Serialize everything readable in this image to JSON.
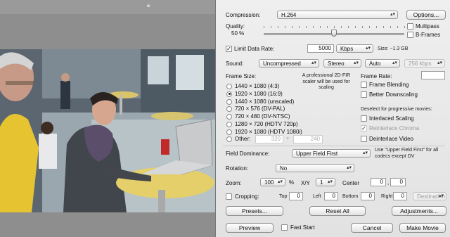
{
  "preview": {
    "glyph": "⚭"
  },
  "compression": {
    "label": "Compression:",
    "value": "H.264",
    "options_button": "Options..."
  },
  "quality": {
    "label": "Quality:",
    "value": "50 %",
    "level": 0.5
  },
  "multipass": {
    "label": "Multipass",
    "checked": false
  },
  "bframes": {
    "label": "B-Frames",
    "checked": false
  },
  "data_rate": {
    "label": "Limit Data Rate:",
    "checked": true,
    "value": "5000",
    "unit": "Kbps",
    "size": "Size: ~1.3 GB"
  },
  "sound": {
    "label": "Sound:",
    "codec": "Uncompressed",
    "channels": "Stereo",
    "rate": "Auto",
    "bitrate": "256 kbps"
  },
  "frame_size": {
    "label": "Frame Size:",
    "note": "A professional 2D-FIR scaler will be used for scaling",
    "options": [
      {
        "label": "1440 × 1080  (4:3)",
        "selected": false
      },
      {
        "label": "1920 × 1080  (16:9)",
        "selected": true
      },
      {
        "label": "1440 × 1080  (unscaled)",
        "selected": false
      },
      {
        "label": "720 × 576  (DV-PAL)",
        "selected": false
      },
      {
        "label": "720 × 480  (DV-NTSC)",
        "selected": false
      },
      {
        "label": "1280 × 720  (HDTV 720p)",
        "selected": false
      },
      {
        "label": "1920 × 1080  (HDTV 1080i)",
        "selected": false
      }
    ],
    "other_label": "Other:",
    "other_width": "320",
    "other_times": "×",
    "other_height": "240"
  },
  "frame_rate": {
    "label": "Frame Rate:",
    "value": "",
    "blending": {
      "label": "Frame Blending",
      "checked": false
    },
    "better": {
      "label": "Better Downscaling",
      "checked": false
    }
  },
  "deselect_note": "Deselect for progressive movies:",
  "interlaced": {
    "label": "Interlaced Scaling",
    "checked": false
  },
  "reinterlace": {
    "label": "Reinterlace Chroma",
    "checked": true,
    "disabled": true
  },
  "deinterlace": {
    "label": "Deinterlace Video",
    "checked": false
  },
  "field_dominance": {
    "label": "Field Dominance:",
    "value": "Upper Field First",
    "note": "Use \"Upper Field First\" for all codecs except DV"
  },
  "rotation": {
    "label": "Rotation:",
    "value": "No"
  },
  "zoom": {
    "label": "Zoom:",
    "value": "100",
    "percent": "%",
    "xy_label": "X/Y",
    "xy_value": "1",
    "center_label": "Center",
    "center_x": "0",
    "center_sep": ",",
    "center_y": "0"
  },
  "cropping": {
    "label": "Cropping:",
    "checked": false,
    "top_label": "Top",
    "top": "0",
    "left_label": "Left",
    "left": "0",
    "bottom_label": "Bottom",
    "bottom": "0",
    "right_label": "Right",
    "right": "0",
    "mode": "Destination"
  },
  "buttons": {
    "presets": "Presets...",
    "reset": "Reset All",
    "adjust": "Adjustments...",
    "preview": "Preview",
    "cancel": "Cancel",
    "make": "Make Movie"
  },
  "fast_start": {
    "label": "Fast Start",
    "checked": false
  }
}
